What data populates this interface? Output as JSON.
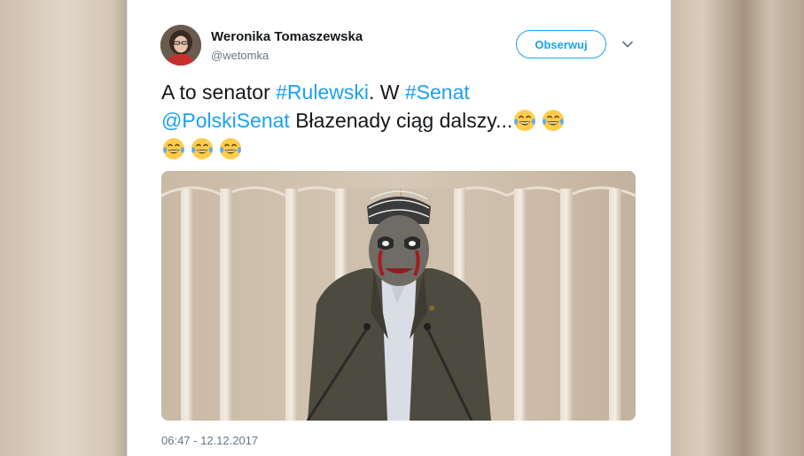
{
  "tweet": {
    "author_name": "Weronika Tomaszewska",
    "author_handle": "@wetomka",
    "follow_label": "Obserwuj",
    "text_part1": "A to senator ",
    "hashtag1": "#Rulewski",
    "text_part2": ". W ",
    "hashtag2": "#Senat",
    "mention": "@PolskiSenat",
    "text_part3": "  Błazenady ciąg dalszy...",
    "emoji_name": "face-with-tears-of-joy",
    "emoji_count": 5,
    "timestamp": "06:47 - 12.12.2017"
  },
  "colors": {
    "accent": "#1da1f2",
    "text": "#14171a",
    "secondary": "#657786"
  },
  "icons": {
    "menu": "chevron-down-icon"
  }
}
